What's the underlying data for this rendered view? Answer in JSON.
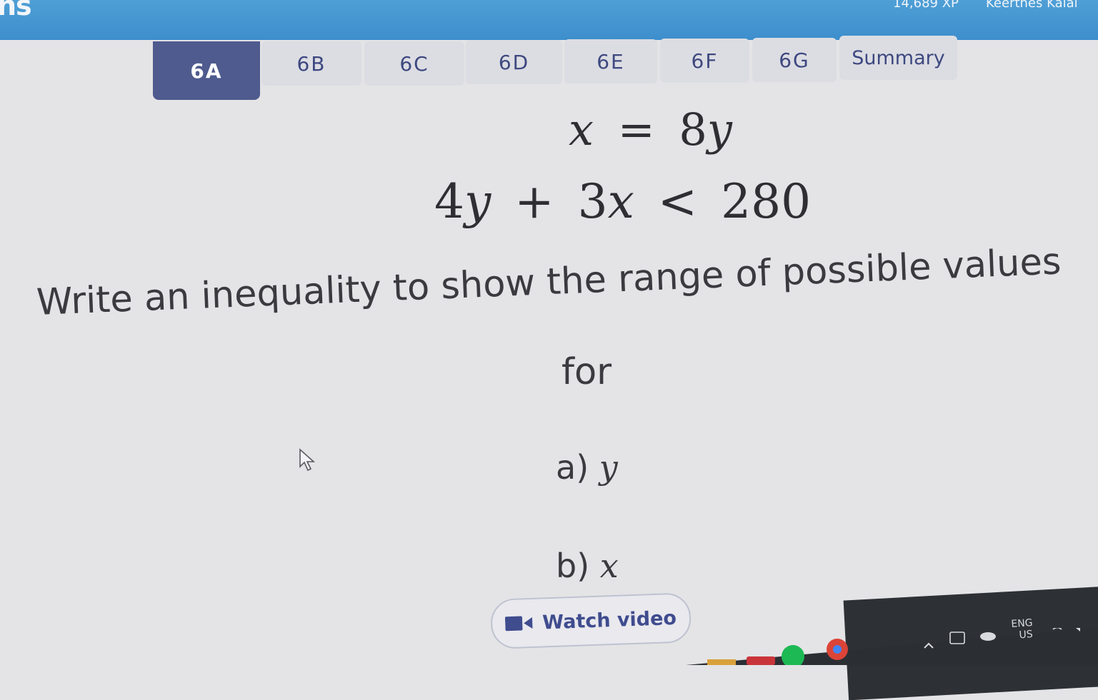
{
  "header": {
    "brand_fragment": "ns",
    "xp": "14,689 XP",
    "user": "Keerthes Kalai"
  },
  "tabs": [
    {
      "label": "6A",
      "active": true
    },
    {
      "label": "6B",
      "active": false
    },
    {
      "label": "6C",
      "active": false
    },
    {
      "label": "6D",
      "active": false
    },
    {
      "label": "6E",
      "active": false
    },
    {
      "label": "6F",
      "active": false
    },
    {
      "label": "6G",
      "active": false
    },
    {
      "label": "Summary",
      "active": false
    }
  ],
  "equations": {
    "eq1": {
      "lhs": "x",
      "op": "=",
      "rhs_coef": "8",
      "rhs_var": "y"
    },
    "eq2": {
      "t1_coef": "4",
      "t1_var": "y",
      "op1": "+",
      "t2_coef": "3",
      "t2_var": "x",
      "op2": "<",
      "value": "280"
    }
  },
  "question": {
    "line1": "Write an inequality to show the range of possible values",
    "line2": "for"
  },
  "parts": [
    {
      "label": "a)",
      "var": "y"
    },
    {
      "label": "b)",
      "var": "x"
    }
  ],
  "video_button": {
    "label": "Watch video",
    "icon": "video-camera-icon"
  },
  "tray": {
    "lang": "ENG",
    "region": "US"
  },
  "colors": {
    "accent": "#4f5a8e",
    "tab_text": "#3e4880",
    "header": "#3d8ecc"
  }
}
